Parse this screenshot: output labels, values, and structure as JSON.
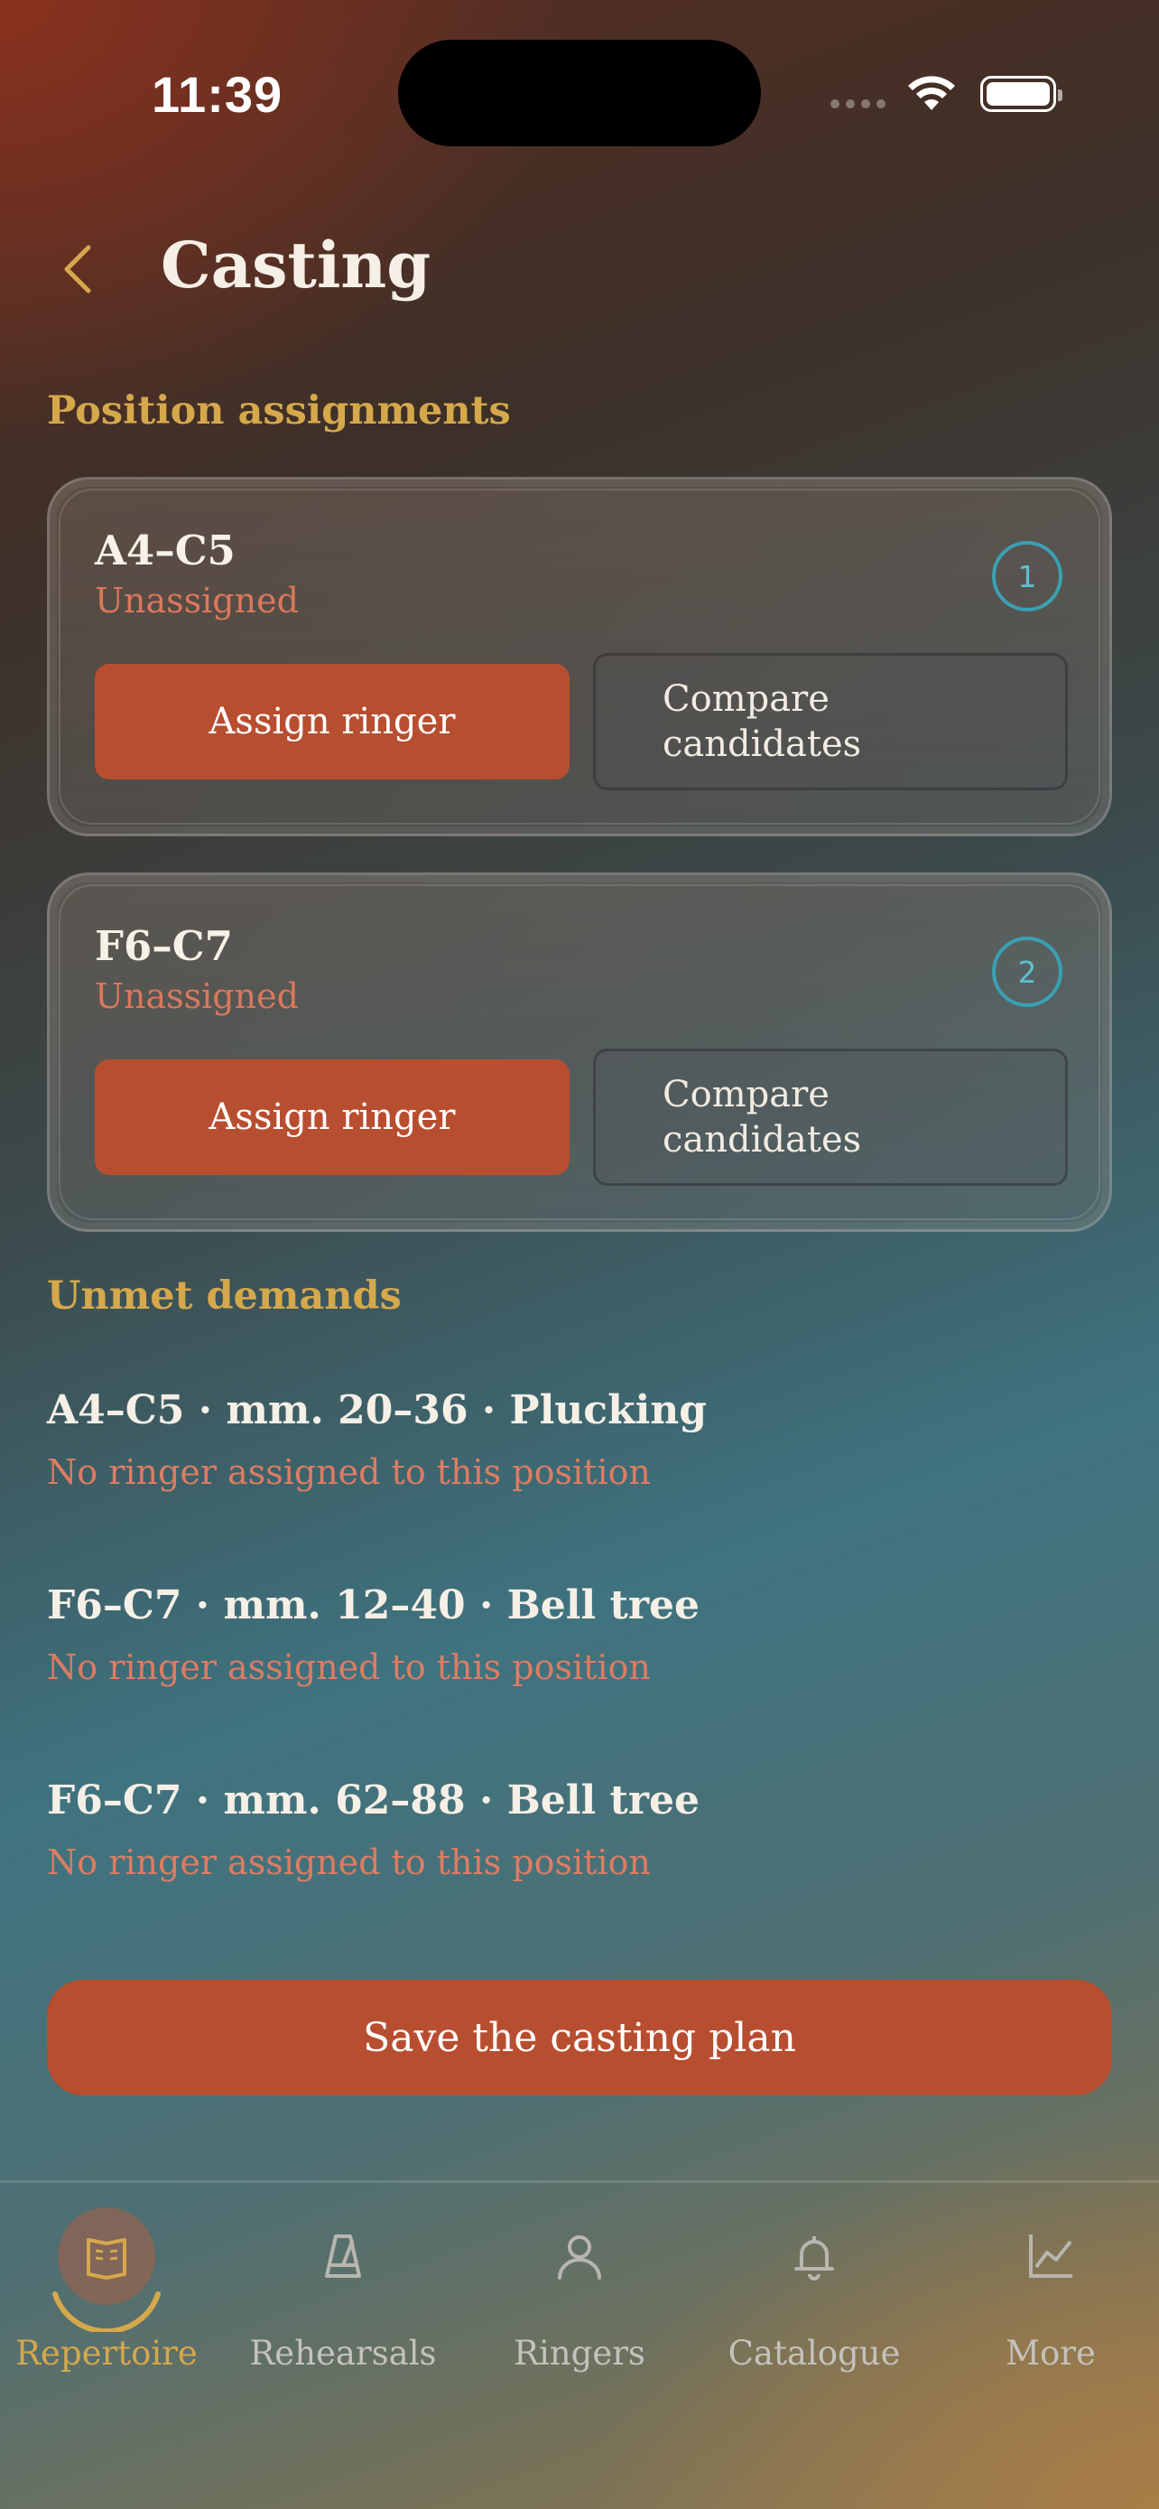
{
  "status": {
    "time": "11:39"
  },
  "header": {
    "title": "Casting"
  },
  "sections": {
    "positions_label": "Position assignments",
    "unmet_label": "Unmet demands"
  },
  "positions": [
    {
      "name": "A4–C5",
      "status": "Unassigned",
      "badge": "1",
      "assign_label": "Assign ringer",
      "compare_line1": "Compare",
      "compare_line2": "candidates"
    },
    {
      "name": "F6–C7",
      "status": "Unassigned",
      "badge": "2",
      "assign_label": "Assign ringer",
      "compare_line1": "Compare",
      "compare_line2": "candidates"
    }
  ],
  "demands": [
    {
      "title": "A4–C5 · mm. 20–36 · Plucking",
      "note": "No ringer assigned to this position"
    },
    {
      "title": "F6–C7 · mm. 12–40 · Bell tree",
      "note": "No ringer assigned to this position"
    },
    {
      "title": "F6–C7 · mm. 62–88 · Bell tree",
      "note": "No ringer assigned to this position"
    }
  ],
  "save_label": "Save the casting plan",
  "tabs": [
    {
      "label": "Repertoire",
      "icon": "book-icon",
      "active": true
    },
    {
      "label": "Rehearsals",
      "icon": "metronome-icon",
      "active": false
    },
    {
      "label": "Ringers",
      "icon": "person-icon",
      "active": false
    },
    {
      "label": "Catalogue",
      "icon": "bell-icon",
      "active": false
    },
    {
      "label": "More",
      "icon": "chart-icon",
      "active": false
    }
  ],
  "colors": {
    "accent": "#b84e30",
    "gold": "#d6a84c",
    "badge": "#3aa0b4",
    "warning_text": "#dc7d63"
  }
}
